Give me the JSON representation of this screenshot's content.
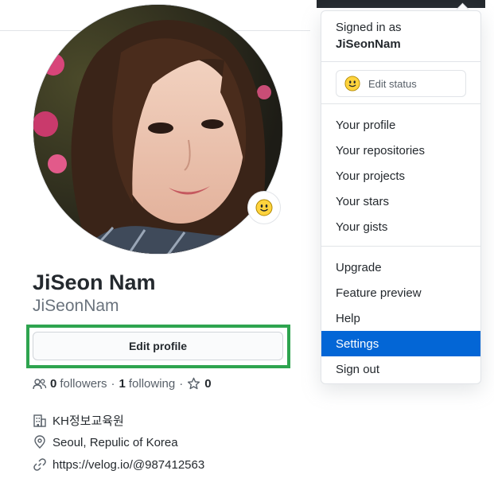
{
  "profile": {
    "name": "JiSeon Nam",
    "login": "JiSeonNam",
    "edit_label": "Edit profile",
    "followers_count": "0",
    "followers_label": "followers",
    "following_count": "1",
    "following_label": "following",
    "separator": "·",
    "stars_count": "0",
    "organization": "KH정보교육원",
    "location": "Seoul, Repulic of Korea",
    "website": "https://velog.io/@987412563"
  },
  "dropdown": {
    "signed_in_as": "Signed in as",
    "username": "JiSeonNam",
    "edit_status": "Edit status",
    "group1": [
      "Your profile",
      "Your repositories",
      "Your projects",
      "Your stars",
      "Your gists"
    ],
    "group2": [
      "Upgrade",
      "Feature preview",
      "Help",
      "Settings",
      "Sign out"
    ],
    "active_item": "Settings"
  },
  "colors": {
    "accent": "#0366d6",
    "highlight": "#2ea44f",
    "header_dark": "#24292e"
  },
  "icons": [
    "smiley-icon",
    "people-icon",
    "star-icon",
    "organization-icon",
    "location-icon",
    "link-icon"
  ]
}
